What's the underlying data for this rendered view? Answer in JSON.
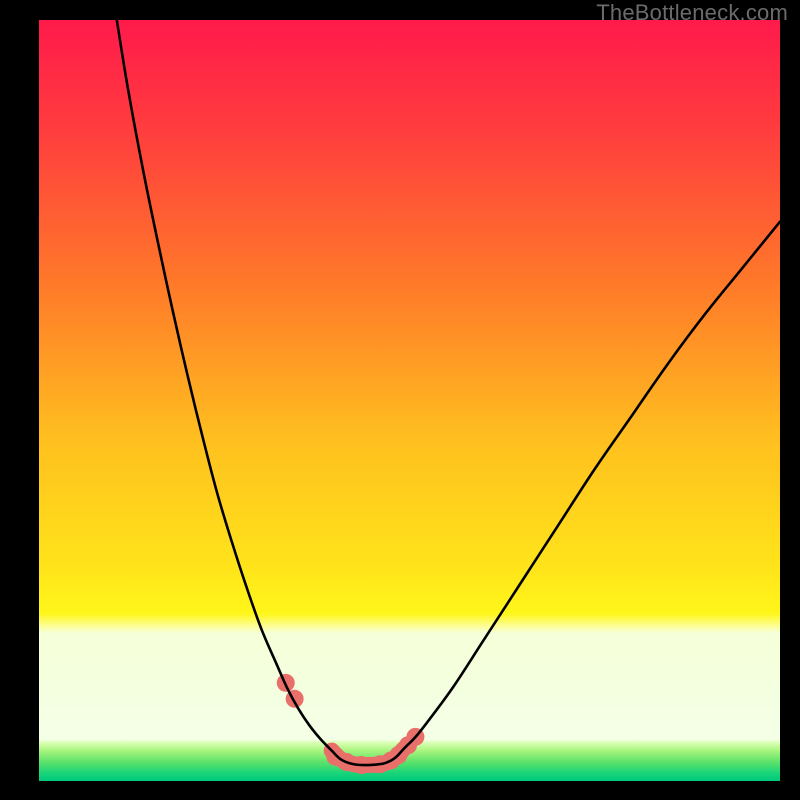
{
  "watermark": "TheBottleneck.com",
  "chart_data": {
    "type": "line",
    "title": "",
    "xlabel": "",
    "ylabel": "",
    "xlim": [
      0,
      100
    ],
    "ylim": [
      0,
      100
    ],
    "grid": false,
    "legend": false,
    "series": [
      {
        "name": "curve-left",
        "x": [
          10.5,
          12,
          14,
          16,
          18,
          20,
          22,
          24,
          26,
          28,
          30,
          32,
          33.5,
          35,
          36.5,
          38,
          39.5
        ],
        "values": [
          100,
          91,
          80.5,
          71,
          62,
          53.5,
          45.5,
          38,
          31.5,
          25.5,
          20,
          15.5,
          12.2,
          9.5,
          7.3,
          5.5,
          4
        ]
      },
      {
        "name": "valley-floor",
        "x": [
          39.5,
          40.8,
          42.5,
          44.5,
          46.5,
          48,
          49.2
        ],
        "values": [
          4,
          2.8,
          2.2,
          2.1,
          2.3,
          3,
          4.2
        ]
      },
      {
        "name": "curve-right",
        "x": [
          49.2,
          51,
          53,
          56,
          60,
          65,
          70,
          75,
          80,
          85,
          90,
          95,
          100
        ],
        "values": [
          4.2,
          6,
          8.5,
          12.5,
          18.5,
          26,
          33.5,
          41,
          48,
          55,
          61.5,
          67.5,
          73.5
        ]
      },
      {
        "name": "marker-dots",
        "type": "scatter",
        "x": [
          33.3,
          34.5,
          40,
          41.5,
          43.5,
          46,
          47.5,
          48.5,
          49.8,
          50.8
        ],
        "values": [
          12.9,
          10.8,
          3.2,
          2.5,
          2.1,
          2.2,
          2.7,
          3.4,
          4.7,
          5.8
        ]
      }
    ],
    "gradient_stops": [
      {
        "offset": 0.0,
        "color": "#ff1a4b"
      },
      {
        "offset": 0.15,
        "color": "#ff3e3d"
      },
      {
        "offset": 0.35,
        "color": "#ff7a29"
      },
      {
        "offset": 0.55,
        "color": "#ffbf1f"
      },
      {
        "offset": 0.72,
        "color": "#ffe41a"
      },
      {
        "offset": 0.78,
        "color": "#fff61a"
      },
      {
        "offset": 0.8,
        "color": "#fbffb0"
      },
      {
        "offset": 0.805,
        "color": "#f5ffd8"
      },
      {
        "offset": 0.945,
        "color": "#f4ffe7"
      },
      {
        "offset": 0.95,
        "color": "#d9ffb3"
      },
      {
        "offset": 0.96,
        "color": "#a8f57e"
      },
      {
        "offset": 0.975,
        "color": "#5de26a"
      },
      {
        "offset": 0.99,
        "color": "#17d47a"
      },
      {
        "offset": 1.0,
        "color": "#00c97c"
      }
    ],
    "marker_radius": 9,
    "marker_color": "#e96f6b",
    "valley_stroke_color": "#e96f6b",
    "valley_stroke_width": 16,
    "curve_stroke_color": "#000000",
    "curve_stroke_width": 2.6
  }
}
